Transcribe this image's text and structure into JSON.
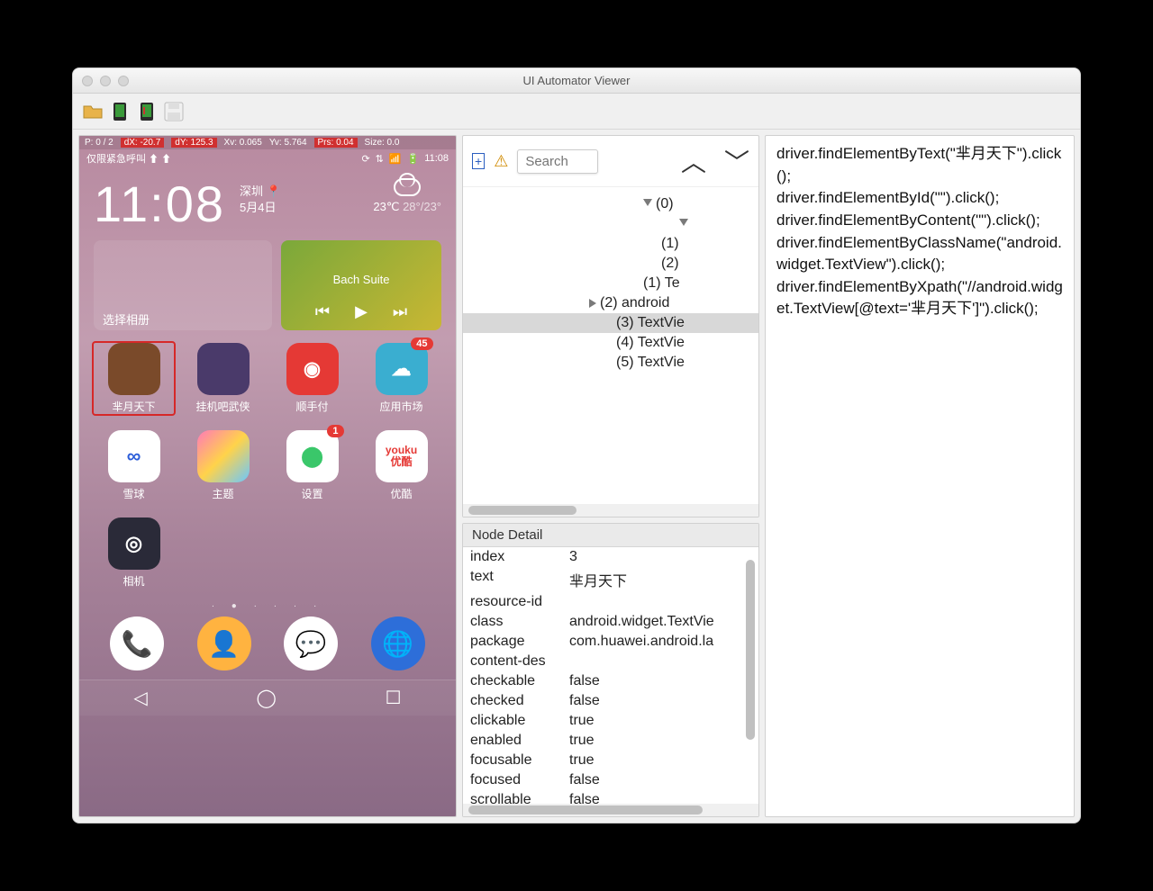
{
  "window": {
    "title": "UI Automator Viewer"
  },
  "dev_overlay": {
    "p": "P: 0 / 2",
    "dx": "dX: -20.7",
    "dy": "dY: 125.3",
    "xv": "Xv: 0.065",
    "yv": "Yv: 5.764",
    "prs": "Prs: 0.04",
    "size": "Size: 0.0"
  },
  "status": {
    "left": "仅限紧急呼叫 ⬆ ⬆",
    "right_items": [
      "⟳",
      "⇅",
      "📶",
      "🔋",
      "11:08"
    ]
  },
  "clock": {
    "time": "11:08",
    "city": "深圳",
    "date": "5月4日",
    "temp": "23℃",
    "temp_range": "28°/23°"
  },
  "album_widget": {
    "label": "选择相册"
  },
  "music_widget": {
    "track": "Bach Suite",
    "prev": "⏮",
    "play": "▶",
    "next": "⏭"
  },
  "apps_row1": [
    {
      "name": "芈月天下",
      "icon_bg": "#7a4a2a",
      "selected": true
    },
    {
      "name": "挂机吧武侠",
      "icon_bg": "#4a3a6a"
    },
    {
      "name": "顺手付",
      "icon_bg": "#e53935",
      "glyph": "◉"
    },
    {
      "name": "应用市场",
      "icon_bg": "#3aaed0",
      "glyph": "☁",
      "badge": "45"
    }
  ],
  "apps_row2": [
    {
      "name": "雪球",
      "icon_bg": "#ffffff",
      "glyph": "∞",
      "glyph_color": "#2d5ed9"
    },
    {
      "name": "主题",
      "icon_bg": "linear-gradient(135deg,#ff7ab8,#ffd34a,#6ac7ff)"
    },
    {
      "name": "设置",
      "icon_bg": "#ffffff",
      "glyph": "⬤",
      "badge": "1",
      "glyph_color": "#3ac76a"
    },
    {
      "name": "优酷",
      "icon_bg": "#ffffff",
      "glyph": "youku\n优酷",
      "glyph_color": "#e53935"
    }
  ],
  "apps_row3": [
    {
      "name": "相机",
      "icon_bg": "#2a2a38",
      "glyph": "◎"
    }
  ],
  "dots": "· ● · · · ·",
  "dock": [
    {
      "glyph": "📞",
      "bg": "#ffffff",
      "color": "#2d6ed9"
    },
    {
      "glyph": "👤",
      "bg": "#ffb340",
      "color": "#fff"
    },
    {
      "glyph": "💬",
      "bg": "#ffffff",
      "color": "#3ac76a"
    },
    {
      "glyph": "🌐",
      "bg": "#2d6ed9",
      "color": "#fff"
    }
  ],
  "nav": {
    "back": "◁",
    "home": "◯",
    "recent": "☐"
  },
  "tree": {
    "search_placeholder": "Search",
    "rows": [
      {
        "indent": 200,
        "pre": "▼",
        "text": "(0)"
      },
      {
        "indent": 240,
        "pre": "▼",
        "text": ""
      },
      {
        "indent": 220,
        "text": "(1)"
      },
      {
        "indent": 220,
        "text": "(2)"
      },
      {
        "indent": 200,
        "text": "(1) Te"
      },
      {
        "indent": 140,
        "pre": "▶",
        "text": "(2) android"
      },
      {
        "indent": 170,
        "text": "(3) TextVie",
        "selected": true
      },
      {
        "indent": 170,
        "text": "(4) TextVie"
      },
      {
        "indent": 170,
        "text": "(5) TextVie"
      }
    ]
  },
  "detail": {
    "header": "Node Detail",
    "rows": [
      [
        "index",
        "3"
      ],
      [
        "text",
        "芈月天下"
      ],
      [
        "resource-id",
        ""
      ],
      [
        "class",
        "android.widget.TextVie"
      ],
      [
        "package",
        "com.huawei.android.la"
      ],
      [
        "content-des",
        ""
      ],
      [
        "checkable",
        "false"
      ],
      [
        "checked",
        "false"
      ],
      [
        "clickable",
        "true"
      ],
      [
        "enabled",
        "true"
      ],
      [
        "focusable",
        "true"
      ],
      [
        "focused",
        "false"
      ],
      [
        "scrollable",
        "false"
      ]
    ]
  },
  "code_lines": [
    "driver.findElementByText(\"芈月天下\").click();",
    "driver.findElementById(\"\").click();",
    "driver.findElementByContent(\"\").click();",
    "driver.findElementByClassName(\"android.widget.TextView\").click();",
    "driver.findElementByXpath(\"//android.widget.TextView[@text='芈月天下']\").click();"
  ]
}
